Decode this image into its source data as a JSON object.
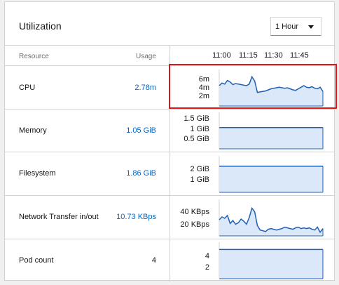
{
  "card": {
    "title": "Utilization",
    "time_select": {
      "value": "1 Hour"
    }
  },
  "table": {
    "col_resource": "Resource",
    "col_usage": "Usage",
    "time_ticks": [
      "11:00",
      "11:15",
      "11:30",
      "11:45"
    ]
  },
  "rows": [
    {
      "name": "CPU",
      "value": "2.78m",
      "link": true,
      "y_ticks": [
        "6m",
        "4m",
        "2m"
      ]
    },
    {
      "name": "Memory",
      "value": "1.05 GiB",
      "link": true,
      "y_ticks": [
        "1.5 GiB",
        "1 GiB",
        "0.5 GiB"
      ]
    },
    {
      "name": "Filesystem",
      "value": "1.86 GiB",
      "link": true,
      "y_ticks": [
        "2 GiB",
        "1 GiB"
      ]
    },
    {
      "name": "Network Transfer in/out",
      "value": "10.73 KBps",
      "link": true,
      "y_ticks": [
        "40 KBps",
        "20 KBps"
      ]
    },
    {
      "name": "Pod count",
      "value": "4",
      "link": false,
      "y_ticks": [
        "4",
        "2"
      ]
    }
  ],
  "chart_data": [
    {
      "type": "area",
      "series_for": "CPU",
      "ylim": [
        0,
        7
      ],
      "values": [
        3.9,
        4.4,
        4.2,
        4.9,
        4.6,
        4.1,
        4.3,
        4.2,
        4.1,
        4.0,
        3.9,
        4.2,
        5.6,
        4.8,
        2.6,
        2.7,
        2.8,
        2.9,
        3.1,
        3.3,
        3.4,
        3.5,
        3.6,
        3.5,
        3.4,
        3.5,
        3.3,
        3.1,
        3.0,
        3.3,
        3.6,
        3.9,
        3.6,
        3.5,
        3.7,
        3.4,
        3.3,
        3.6,
        2.8
      ]
    },
    {
      "type": "area",
      "series_for": "Memory",
      "ylim": [
        0,
        1.8
      ],
      "values": [
        1.05,
        1.05,
        1.05,
        1.05,
        1.05,
        1.05,
        1.05,
        1.05,
        1.05,
        1.05
      ]
    },
    {
      "type": "area",
      "series_for": "Filesystem",
      "ylim": [
        0,
        2.6
      ],
      "values": [
        1.86,
        1.86,
        1.86,
        1.86,
        1.86,
        1.86,
        1.86,
        1.86,
        1.86,
        1.86
      ]
    },
    {
      "type": "area",
      "series_for": "Network Transfer in/out",
      "ylim": [
        0,
        50
      ],
      "values": [
        22,
        26,
        24,
        28,
        17,
        21,
        16,
        18,
        23,
        20,
        16,
        25,
        38,
        33,
        14,
        8,
        7,
        6,
        9,
        10,
        9,
        8,
        9,
        10,
        12,
        11,
        10,
        9,
        11,
        12,
        10,
        11,
        10,
        11,
        9,
        8,
        12,
        5,
        10
      ]
    },
    {
      "type": "area",
      "series_for": "Pod count",
      "ylim": [
        0,
        5
      ],
      "values": [
        4,
        4,
        4,
        4,
        4,
        4,
        4,
        4,
        4,
        4
      ]
    }
  ],
  "colors": {
    "line": "#1f5fb4",
    "fill": "#dbe8fa",
    "link": "#0066cc",
    "highlight": "#d7191c"
  }
}
